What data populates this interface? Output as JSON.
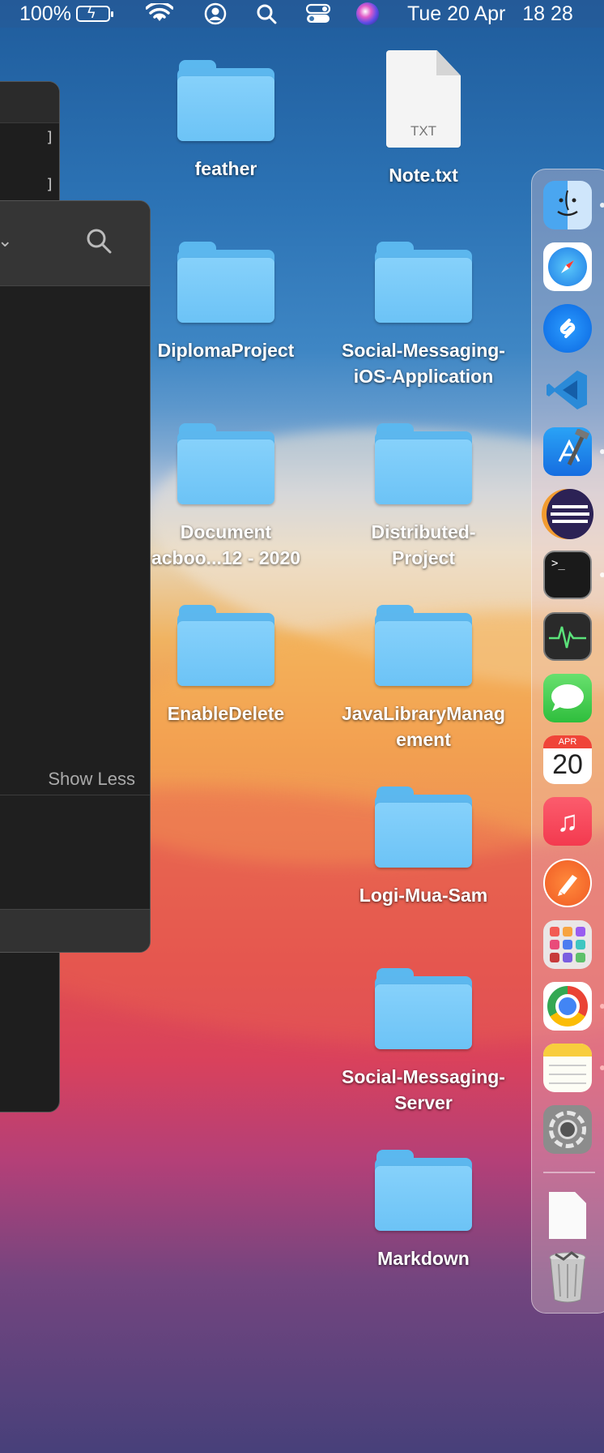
{
  "menubar": {
    "battery_percent": "100%",
    "battery_icon": "battery-charging-icon",
    "wifi_icon": "wifi-icon",
    "user_icon": "user-icon",
    "search_icon": "search-icon",
    "control_center_icon": "control-center-icon",
    "siri_icon": "siri-icon",
    "datetime": "Tue 20 Apr   18 28"
  },
  "windows": {
    "show_less": "Show Less"
  },
  "desktop": {
    "items": [
      {
        "label": "feather",
        "type": "folder"
      },
      {
        "label": "Note.txt",
        "type": "txt",
        "ext": "TXT"
      },
      {
        "label": "DiplomaProject",
        "type": "folder"
      },
      {
        "label": "Social-Messaging-\niOS-Application",
        "type": "folder"
      },
      {
        "label": "Document\nacboo...12 - 2020",
        "type": "folder"
      },
      {
        "label": "Distributed-\nProject",
        "type": "folder"
      },
      {
        "label": "EnableDelete",
        "type": "folder"
      },
      {
        "label": "JavaLibraryManag\nement",
        "type": "folder"
      },
      {
        "label": "Logi-Mua-Sam",
        "type": "folder"
      },
      {
        "label": "Social-Messaging-\nServer",
        "type": "folder"
      },
      {
        "label": "Markdown",
        "type": "folder"
      }
    ]
  },
  "dock": {
    "apps": [
      {
        "name": "finder-icon",
        "running": true
      },
      {
        "name": "safari-icon",
        "running": false
      },
      {
        "name": "shazam-icon",
        "running": false
      },
      {
        "name": "vscode-icon",
        "running": false
      },
      {
        "name": "xcode-icon",
        "running": true
      },
      {
        "name": "eclipse-icon",
        "running": false
      },
      {
        "name": "terminal-icon",
        "running": true
      },
      {
        "name": "activity-monitor-icon",
        "running": false
      },
      {
        "name": "messages-icon",
        "running": false
      },
      {
        "name": "calendar-icon",
        "running": false
      },
      {
        "name": "music-icon",
        "running": false
      },
      {
        "name": "pixelmator-icon",
        "running": false
      },
      {
        "name": "launchpad-icon",
        "running": false
      },
      {
        "name": "chrome-icon",
        "running": true
      },
      {
        "name": "notes-icon",
        "running": true
      },
      {
        "name": "system-preferences-icon",
        "running": false
      }
    ],
    "calendar_month": "APR",
    "calendar_day": "20",
    "terminal_prompt": ">_",
    "document_icon": "document-icon",
    "trash_icon": "trash-icon"
  }
}
